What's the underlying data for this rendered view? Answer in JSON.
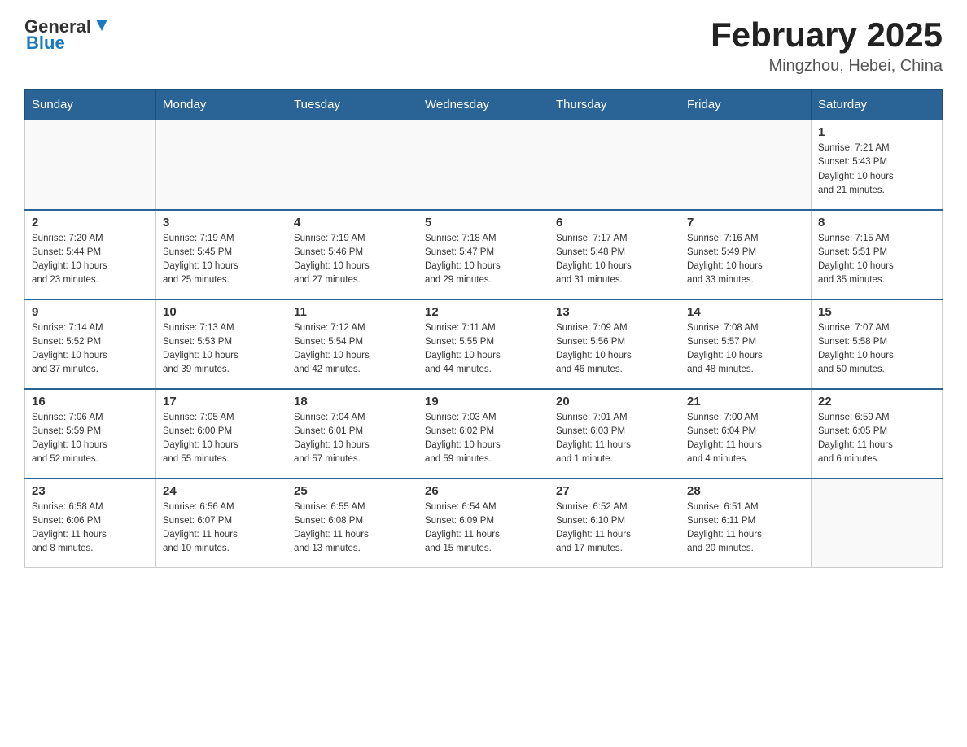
{
  "header": {
    "logo_general": "General",
    "logo_blue": "Blue",
    "month_title": "February 2025",
    "location": "Mingzhou, Hebei, China"
  },
  "weekdays": [
    "Sunday",
    "Monday",
    "Tuesday",
    "Wednesday",
    "Thursday",
    "Friday",
    "Saturday"
  ],
  "weeks": [
    [
      {
        "day": "",
        "info": ""
      },
      {
        "day": "",
        "info": ""
      },
      {
        "day": "",
        "info": ""
      },
      {
        "day": "",
        "info": ""
      },
      {
        "day": "",
        "info": ""
      },
      {
        "day": "",
        "info": ""
      },
      {
        "day": "1",
        "info": "Sunrise: 7:21 AM\nSunset: 5:43 PM\nDaylight: 10 hours\nand 21 minutes."
      }
    ],
    [
      {
        "day": "2",
        "info": "Sunrise: 7:20 AM\nSunset: 5:44 PM\nDaylight: 10 hours\nand 23 minutes."
      },
      {
        "day": "3",
        "info": "Sunrise: 7:19 AM\nSunset: 5:45 PM\nDaylight: 10 hours\nand 25 minutes."
      },
      {
        "day": "4",
        "info": "Sunrise: 7:19 AM\nSunset: 5:46 PM\nDaylight: 10 hours\nand 27 minutes."
      },
      {
        "day": "5",
        "info": "Sunrise: 7:18 AM\nSunset: 5:47 PM\nDaylight: 10 hours\nand 29 minutes."
      },
      {
        "day": "6",
        "info": "Sunrise: 7:17 AM\nSunset: 5:48 PM\nDaylight: 10 hours\nand 31 minutes."
      },
      {
        "day": "7",
        "info": "Sunrise: 7:16 AM\nSunset: 5:49 PM\nDaylight: 10 hours\nand 33 minutes."
      },
      {
        "day": "8",
        "info": "Sunrise: 7:15 AM\nSunset: 5:51 PM\nDaylight: 10 hours\nand 35 minutes."
      }
    ],
    [
      {
        "day": "9",
        "info": "Sunrise: 7:14 AM\nSunset: 5:52 PM\nDaylight: 10 hours\nand 37 minutes."
      },
      {
        "day": "10",
        "info": "Sunrise: 7:13 AM\nSunset: 5:53 PM\nDaylight: 10 hours\nand 39 minutes."
      },
      {
        "day": "11",
        "info": "Sunrise: 7:12 AM\nSunset: 5:54 PM\nDaylight: 10 hours\nand 42 minutes."
      },
      {
        "day": "12",
        "info": "Sunrise: 7:11 AM\nSunset: 5:55 PM\nDaylight: 10 hours\nand 44 minutes."
      },
      {
        "day": "13",
        "info": "Sunrise: 7:09 AM\nSunset: 5:56 PM\nDaylight: 10 hours\nand 46 minutes."
      },
      {
        "day": "14",
        "info": "Sunrise: 7:08 AM\nSunset: 5:57 PM\nDaylight: 10 hours\nand 48 minutes."
      },
      {
        "day": "15",
        "info": "Sunrise: 7:07 AM\nSunset: 5:58 PM\nDaylight: 10 hours\nand 50 minutes."
      }
    ],
    [
      {
        "day": "16",
        "info": "Sunrise: 7:06 AM\nSunset: 5:59 PM\nDaylight: 10 hours\nand 52 minutes."
      },
      {
        "day": "17",
        "info": "Sunrise: 7:05 AM\nSunset: 6:00 PM\nDaylight: 10 hours\nand 55 minutes."
      },
      {
        "day": "18",
        "info": "Sunrise: 7:04 AM\nSunset: 6:01 PM\nDaylight: 10 hours\nand 57 minutes."
      },
      {
        "day": "19",
        "info": "Sunrise: 7:03 AM\nSunset: 6:02 PM\nDaylight: 10 hours\nand 59 minutes."
      },
      {
        "day": "20",
        "info": "Sunrise: 7:01 AM\nSunset: 6:03 PM\nDaylight: 11 hours\nand 1 minute."
      },
      {
        "day": "21",
        "info": "Sunrise: 7:00 AM\nSunset: 6:04 PM\nDaylight: 11 hours\nand 4 minutes."
      },
      {
        "day": "22",
        "info": "Sunrise: 6:59 AM\nSunset: 6:05 PM\nDaylight: 11 hours\nand 6 minutes."
      }
    ],
    [
      {
        "day": "23",
        "info": "Sunrise: 6:58 AM\nSunset: 6:06 PM\nDaylight: 11 hours\nand 8 minutes."
      },
      {
        "day": "24",
        "info": "Sunrise: 6:56 AM\nSunset: 6:07 PM\nDaylight: 11 hours\nand 10 minutes."
      },
      {
        "day": "25",
        "info": "Sunrise: 6:55 AM\nSunset: 6:08 PM\nDaylight: 11 hours\nand 13 minutes."
      },
      {
        "day": "26",
        "info": "Sunrise: 6:54 AM\nSunset: 6:09 PM\nDaylight: 11 hours\nand 15 minutes."
      },
      {
        "day": "27",
        "info": "Sunrise: 6:52 AM\nSunset: 6:10 PM\nDaylight: 11 hours\nand 17 minutes."
      },
      {
        "day": "28",
        "info": "Sunrise: 6:51 AM\nSunset: 6:11 PM\nDaylight: 11 hours\nand 20 minutes."
      },
      {
        "day": "",
        "info": ""
      }
    ]
  ]
}
